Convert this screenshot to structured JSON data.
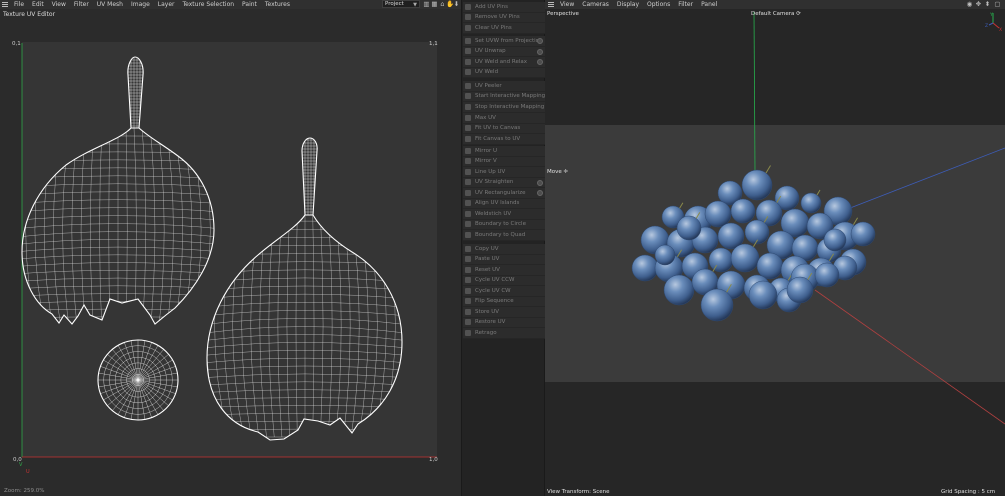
{
  "uv_editor": {
    "menu": [
      "File",
      "Edit",
      "View",
      "Filter",
      "UV Mesh",
      "Image",
      "Layer",
      "Texture Selection",
      "Paint",
      "Textures"
    ],
    "project_select": "Project",
    "title": "Texture UV Editor",
    "corner_top_left": "0,1",
    "corner_top_right": "1,1",
    "corner_bottom_left": "0,0",
    "corner_bottom_right": "1,0",
    "axis_v": "V",
    "axis_u": "U",
    "zoom": "Zoom: 259.0%",
    "toolbar_icons": [
      "histogram-icon",
      "grid-icon",
      "lock-icon",
      "hand-icon",
      "download-icon"
    ]
  },
  "uv_commands": {
    "groups": [
      {
        "items": [
          {
            "label": "Add UV Pins",
            "icon": "pin-icon",
            "gear": false
          },
          {
            "label": "Remove UV Pins",
            "icon": "pin-remove-icon",
            "gear": false
          },
          {
            "label": "Clear UV Pins",
            "icon": "pin-clear-icon",
            "gear": false
          }
        ]
      },
      {
        "items": [
          {
            "label": "Set UVW from Projection",
            "icon": "projection-icon",
            "gear": true
          },
          {
            "label": "UV Unwrap",
            "icon": "unwrap-icon",
            "gear": true
          },
          {
            "label": "UV Weld and Relax",
            "icon": "weld-relax-icon",
            "gear": true
          },
          {
            "label": "UV Weld",
            "icon": "weld-icon",
            "gear": false
          }
        ]
      },
      {
        "items": [
          {
            "label": "UV Peeler",
            "icon": "peeler-icon",
            "gear": false
          },
          {
            "label": "Start Interactive Mapping",
            "icon": "start-mapping-icon",
            "gear": false
          },
          {
            "label": "Stop Interactive Mapping",
            "icon": "stop-mapping-icon",
            "gear": false
          }
        ]
      },
      {
        "items": [
          {
            "label": "Max UV",
            "icon": "max-uv-icon",
            "gear": false
          },
          {
            "label": "Fit UV to Canvas",
            "icon": "fit-uv-icon",
            "gear": false
          },
          {
            "label": "Fit Canvas to UV",
            "icon": "fit-canvas-icon",
            "gear": false
          }
        ]
      },
      {
        "items": [
          {
            "label": "Mirror U",
            "icon": "mirror-u-icon",
            "gear": false
          },
          {
            "label": "Mirror V",
            "icon": "mirror-v-icon",
            "gear": false
          },
          {
            "label": "Line Up UV",
            "icon": "line-up-icon",
            "gear": false
          },
          {
            "label": "UV Straighten",
            "icon": "straighten-icon",
            "gear": true
          },
          {
            "label": "UV Rectangularize",
            "icon": "rectangularize-icon",
            "gear": true
          },
          {
            "label": "Align UV Islands",
            "icon": "align-islands-icon",
            "gear": false
          },
          {
            "label": "Weldstich UV",
            "icon": "weldstich-icon",
            "gear": false
          },
          {
            "label": "Boundary to Circle",
            "icon": "boundary-circle-icon",
            "gear": false
          },
          {
            "label": "Boundary to Quad",
            "icon": "boundary-quad-icon",
            "gear": false
          }
        ]
      },
      {
        "items": [
          {
            "label": "Copy UV",
            "icon": "copy-icon",
            "gear": false
          },
          {
            "label": "Paste UV",
            "icon": "paste-icon",
            "gear": false
          },
          {
            "label": "Reset UV",
            "icon": "reset-icon",
            "gear": false
          },
          {
            "label": "Cycle UV CCW",
            "icon": "cycle-ccw-icon",
            "gear": false
          },
          {
            "label": "Cycle UV CW",
            "icon": "cycle-cw-icon",
            "gear": false
          },
          {
            "label": "Flip Sequence",
            "icon": "flip-icon",
            "gear": false
          },
          {
            "label": "Store UV",
            "icon": "store-icon",
            "gear": false
          },
          {
            "label": "Restore UV",
            "icon": "restore-icon",
            "gear": false
          },
          {
            "label": "Retrago",
            "icon": "retrago-icon",
            "gear": false
          }
        ]
      }
    ]
  },
  "viewport": {
    "menu": [
      "View",
      "Cameras",
      "Display",
      "Options",
      "Filter",
      "Panel"
    ],
    "view_name": "Perspective",
    "camera": "Default Camera",
    "camera_icon": "camera-cycle-icon",
    "tool_hint": "Move",
    "tool_hint_icon": "move-cross-icon",
    "view_transform": "View Transform: Scene",
    "grid_spacing": "Grid Spacing : 5 cm",
    "nav_icons": [
      "orbit-icon",
      "pan-icon",
      "zoom-icon",
      "maximize-icon"
    ],
    "axis_y": "Y",
    "axis_x": "X",
    "axis_z": "Z"
  },
  "colors": {
    "uv_wire": "#ffffff",
    "uv_bg": "#353535",
    "axis_v": "#2ea84a",
    "axis_u": "#c83232",
    "berry": "#4a6c9c",
    "berry_dark": "#2f4a72",
    "berry_light": "#a7bcd8",
    "vp_axis_green": "#27b04d",
    "vp_axis_red": "#b04040",
    "vp_axis_blue": "#3d5db8"
  }
}
